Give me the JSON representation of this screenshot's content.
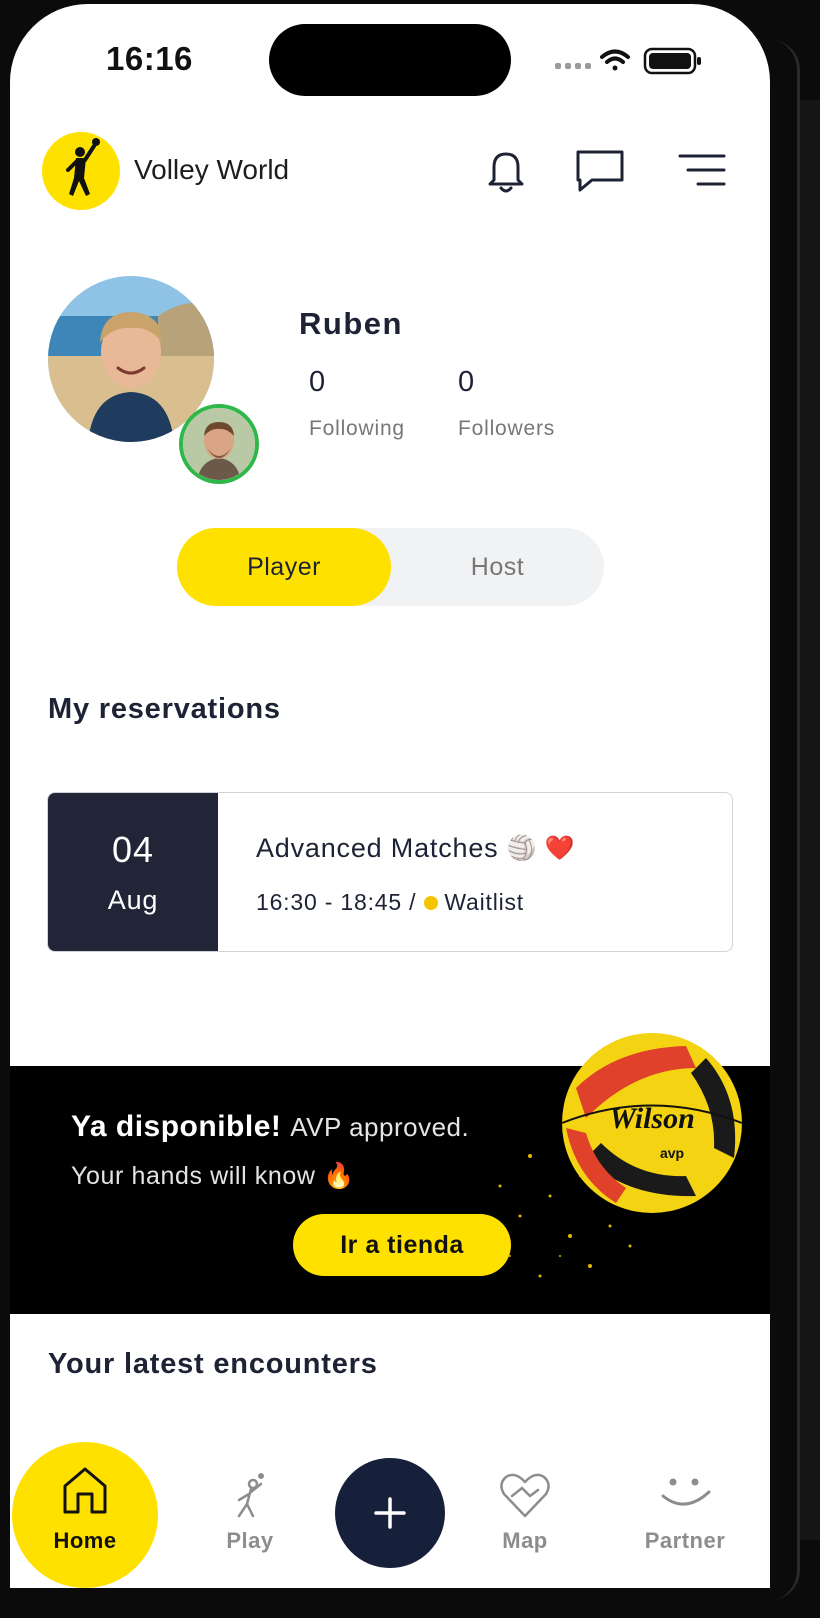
{
  "status_bar": {
    "time": "16:16"
  },
  "header": {
    "app_title": "Volley World"
  },
  "profile": {
    "name": "Ruben",
    "following_count": "0",
    "following_label": "Following",
    "followers_count": "0",
    "followers_label": "Followers"
  },
  "role_toggle": {
    "player_label": "Player",
    "host_label": "Host",
    "selected": "Player"
  },
  "reservations": {
    "title": "My reservations",
    "items": [
      {
        "day": "04",
        "month": "Aug",
        "title": "Advanced Matches",
        "emojis": "🏐 ❤️",
        "time": "16:30 - 18:45 /",
        "status": "Waitlist"
      }
    ]
  },
  "banner": {
    "headline_bold": "Ya disponible!",
    "headline_rest": "AVP approved.",
    "subline": "Your hands will know 🔥",
    "button_label": "Ir a tienda",
    "ball_brand": "Wilson"
  },
  "encounters": {
    "title": "Your latest encounters"
  },
  "bottom_nav": {
    "items": [
      {
        "label": "Home",
        "icon": "home-icon"
      },
      {
        "label": "Play",
        "icon": "player-icon"
      },
      {
        "label": "Map",
        "icon": "heart-map-icon"
      },
      {
        "label": "Partner",
        "icon": "smile-icon"
      }
    ],
    "add_icon": "plus-icon"
  },
  "colors": {
    "accent": "#FFE100",
    "navy": "#16203a",
    "date_block": "#222438",
    "status_waitlist": "#F5C400"
  }
}
